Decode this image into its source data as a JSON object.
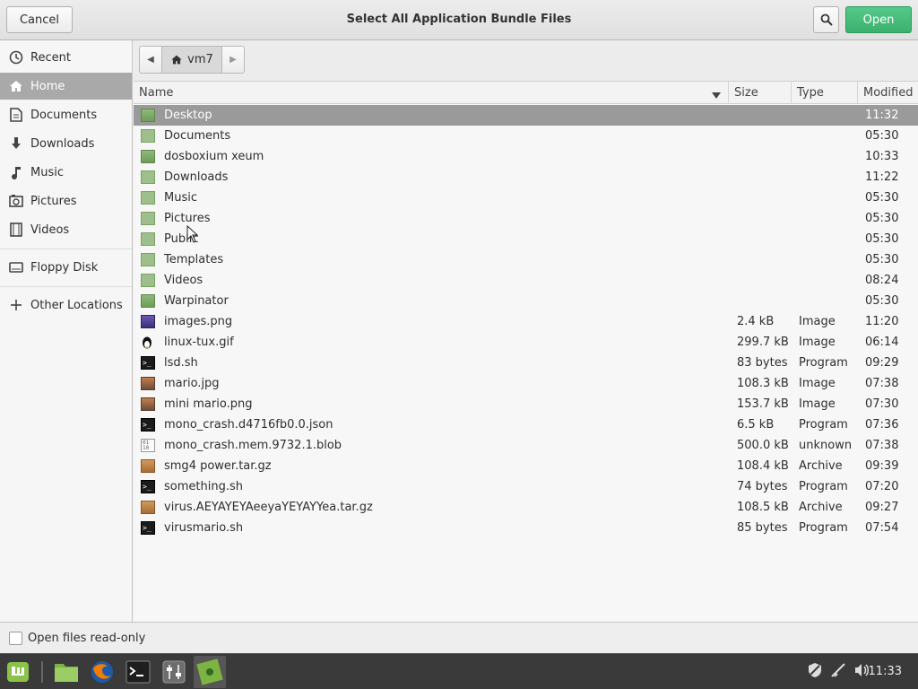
{
  "window": {
    "title": "Select All Application Bundle Files",
    "cancel_label": "Cancel",
    "open_label": "Open"
  },
  "sidebar": {
    "items": [
      {
        "label": "Recent",
        "icon": "clock-icon"
      },
      {
        "label": "Home",
        "icon": "home-icon",
        "active": true
      },
      {
        "label": "Documents",
        "icon": "document-icon"
      },
      {
        "label": "Downloads",
        "icon": "download-icon"
      },
      {
        "label": "Music",
        "icon": "music-icon"
      },
      {
        "label": "Pictures",
        "icon": "picture-icon"
      },
      {
        "label": "Videos",
        "icon": "film-icon"
      },
      {
        "label": "Floppy Disk",
        "icon": "drive-icon"
      },
      {
        "label": "Other Locations",
        "icon": "plus-icon"
      }
    ]
  },
  "pathbar": {
    "current": "vm7"
  },
  "columns": {
    "name": "Name",
    "size": "Size",
    "type": "Type",
    "modified": "Modified"
  },
  "files": [
    {
      "name": "Desktop",
      "size": "",
      "type": "",
      "modified": "11:32",
      "icon": "folder-desktop-icon"
    },
    {
      "name": "Documents",
      "size": "",
      "type": "",
      "modified": "05:30",
      "icon": "folder-documents-icon"
    },
    {
      "name": "dosboxium xeum",
      "size": "",
      "type": "",
      "modified": "10:33",
      "icon": "folder-icon"
    },
    {
      "name": "Downloads",
      "size": "",
      "type": "",
      "modified": "11:22",
      "icon": "folder-downloads-icon"
    },
    {
      "name": "Music",
      "size": "",
      "type": "",
      "modified": "05:30",
      "icon": "folder-music-icon"
    },
    {
      "name": "Pictures",
      "size": "",
      "type": "",
      "modified": "05:30",
      "icon": "folder-pictures-icon"
    },
    {
      "name": "Public",
      "size": "",
      "type": "",
      "modified": "05:30",
      "icon": "folder-public-icon"
    },
    {
      "name": "Templates",
      "size": "",
      "type": "",
      "modified": "05:30",
      "icon": "folder-templates-icon"
    },
    {
      "name": "Videos",
      "size": "",
      "type": "",
      "modified": "08:24",
      "icon": "folder-videos-icon"
    },
    {
      "name": "Warpinator",
      "size": "",
      "type": "",
      "modified": "05:30",
      "icon": "folder-icon"
    },
    {
      "name": "images.png",
      "size": "2.4 kB",
      "type": "Image",
      "modified": "11:20",
      "icon": "image-icon"
    },
    {
      "name": "linux-tux.gif",
      "size": "299.7 kB",
      "type": "Image",
      "modified": "06:14",
      "icon": "tux-icon"
    },
    {
      "name": "lsd.sh",
      "size": "83 bytes",
      "type": "Program",
      "modified": "09:29",
      "icon": "terminal-icon"
    },
    {
      "name": "mario.jpg",
      "size": "108.3 kB",
      "type": "Image",
      "modified": "07:38",
      "icon": "image-icon"
    },
    {
      "name": "mini mario.png",
      "size": "153.7 kB",
      "type": "Image",
      "modified": "07:30",
      "icon": "image-icon"
    },
    {
      "name": "mono_crash.d4716fb0.0.json",
      "size": "6.5 kB",
      "type": "Program",
      "modified": "07:36",
      "icon": "terminal-icon"
    },
    {
      "name": "mono_crash.mem.9732.1.blob",
      "size": "500.0 kB",
      "type": "unknown",
      "modified": "07:38",
      "icon": "binary-icon"
    },
    {
      "name": "smg4 power.tar.gz",
      "size": "108.4 kB",
      "type": "Archive",
      "modified": "09:39",
      "icon": "archive-icon"
    },
    {
      "name": "something.sh",
      "size": "74 bytes",
      "type": "Program",
      "modified": "07:20",
      "icon": "terminal-icon"
    },
    {
      "name": "virus.AEYAYEYAeeyaYEYAYYea.tar.gz",
      "size": "108.5 kB",
      "type": "Archive",
      "modified": "09:27",
      "icon": "archive-icon"
    },
    {
      "name": "virusmario.sh",
      "size": "85 bytes",
      "type": "Program",
      "modified": "07:54",
      "icon": "terminal-icon"
    }
  ],
  "footer": {
    "readonly_label": "Open files read-only",
    "readonly_checked": false
  },
  "taskbar": {
    "clock": "11:33",
    "apps": [
      "mint-menu-icon",
      "files-icon",
      "firefox-icon",
      "terminal-icon",
      "settings-icon",
      "app-icon"
    ]
  },
  "colors": {
    "accent": "#3cb06e",
    "selection": "#9a9a9a",
    "taskbar": "#3a3a3a"
  }
}
